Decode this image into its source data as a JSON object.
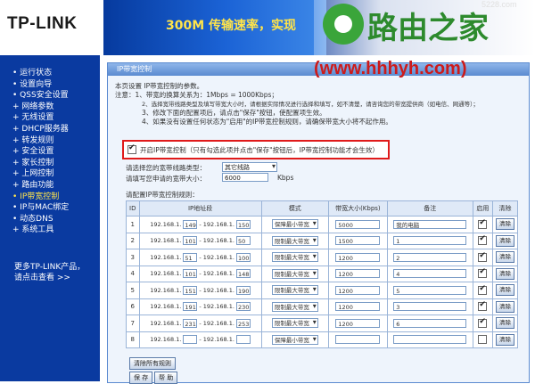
{
  "header": {
    "brand": "TP-LINK",
    "slogan": "300M 传输速率，实现",
    "watermark_host": "5228.com"
  },
  "watermark": {
    "title": "路由之家",
    "url": "(www.hhhyh.com)"
  },
  "sidebar": {
    "items": [
      {
        "label": "• 运行状态"
      },
      {
        "label": "• 设置向导"
      },
      {
        "label": "• QSS安全设置"
      },
      {
        "label": "+ 网络参数"
      },
      {
        "label": "+ 无线设置"
      },
      {
        "label": "+ DHCP服务器"
      },
      {
        "label": "+ 转发规则"
      },
      {
        "label": "+ 安全设置"
      },
      {
        "label": "+ 家长控制"
      },
      {
        "label": "+ 上网控制"
      },
      {
        "label": "+ 路由功能"
      },
      {
        "label": "• IP带宽控制"
      },
      {
        "label": "• IP与MAC绑定"
      },
      {
        "label": "• 动态DNS"
      },
      {
        "label": "+ 系统工具"
      }
    ],
    "active_index": 11,
    "more_line1": "更多TP-LINK产品，",
    "more_line2": "请点击查看 >>"
  },
  "panel": {
    "title": "IP带宽控制",
    "intro": "本页设置 IP带宽控制的参数。",
    "notes": [
      "注意：1、带宽的换算关系为：1Mbps = 1000Kbps；",
      "2、选择宽带线路类型及填写带宽大小时，请根据实际情况进行选择和填写，如不清楚，请咨询您的带宽提供商（如电信、网通等）；",
      "3、修改下面的配置项后，请点击\"保存\"按钮，使配置项生效。",
      "4、如果没有设置任何状态为\"启用\"的IP带宽控制规则，请确保带宽大小将不起作用。"
    ],
    "enable_label": "开启IP带宽控制（只有勾选此项并点击\"保存\"按钮后，IP带宽控制功能才会生效）",
    "enable_checked": true,
    "line_type_label": "请选择您的宽带线路类型：",
    "line_type_value": "其它线路",
    "bandwidth_label": "请填写您申请的宽带大小：",
    "bandwidth_value": "6000",
    "bandwidth_unit": "Kbps",
    "rules_label": "请配置IP带宽控制规则："
  },
  "table": {
    "headers": [
      "ID",
      "IP地址段",
      "模式",
      "带宽大小(Kbps)",
      "备注",
      "启用",
      "清除"
    ],
    "ip_prefix": "192.168.1.",
    "dash": "-",
    "clear_label": "清除",
    "rows": [
      {
        "id": "1",
        "start": "149",
        "end": "150",
        "mode": "保障最小带宽",
        "bw": "5000",
        "note": "我的电脑",
        "enabled": true
      },
      {
        "id": "2",
        "start": "101",
        "end": "50",
        "mode": "限制最大带宽",
        "bw": "1500",
        "note": "1",
        "enabled": true
      },
      {
        "id": "3",
        "start": "51",
        "end": "100",
        "mode": "限制最大带宽",
        "bw": "1200",
        "note": "2",
        "enabled": true
      },
      {
        "id": "4",
        "start": "101",
        "end": "148",
        "mode": "限制最大带宽",
        "bw": "1200",
        "note": "4",
        "enabled": true
      },
      {
        "id": "5",
        "start": "151",
        "end": "190",
        "mode": "限制最大带宽",
        "bw": "1200",
        "note": "5",
        "enabled": true
      },
      {
        "id": "6",
        "start": "191",
        "end": "230",
        "mode": "限制最大带宽",
        "bw": "1200",
        "note": "3",
        "enabled": true
      },
      {
        "id": "7",
        "start": "231",
        "end": "253",
        "mode": "限制最大带宽",
        "bw": "1200",
        "note": "6",
        "enabled": true
      },
      {
        "id": "8",
        "start": "",
        "end": "",
        "mode": "保障最小带宽",
        "bw": "",
        "note": "",
        "enabled": false
      }
    ]
  },
  "buttons": {
    "clear_all": "清除所有规则",
    "save": "保 存",
    "help": "帮 助"
  }
}
